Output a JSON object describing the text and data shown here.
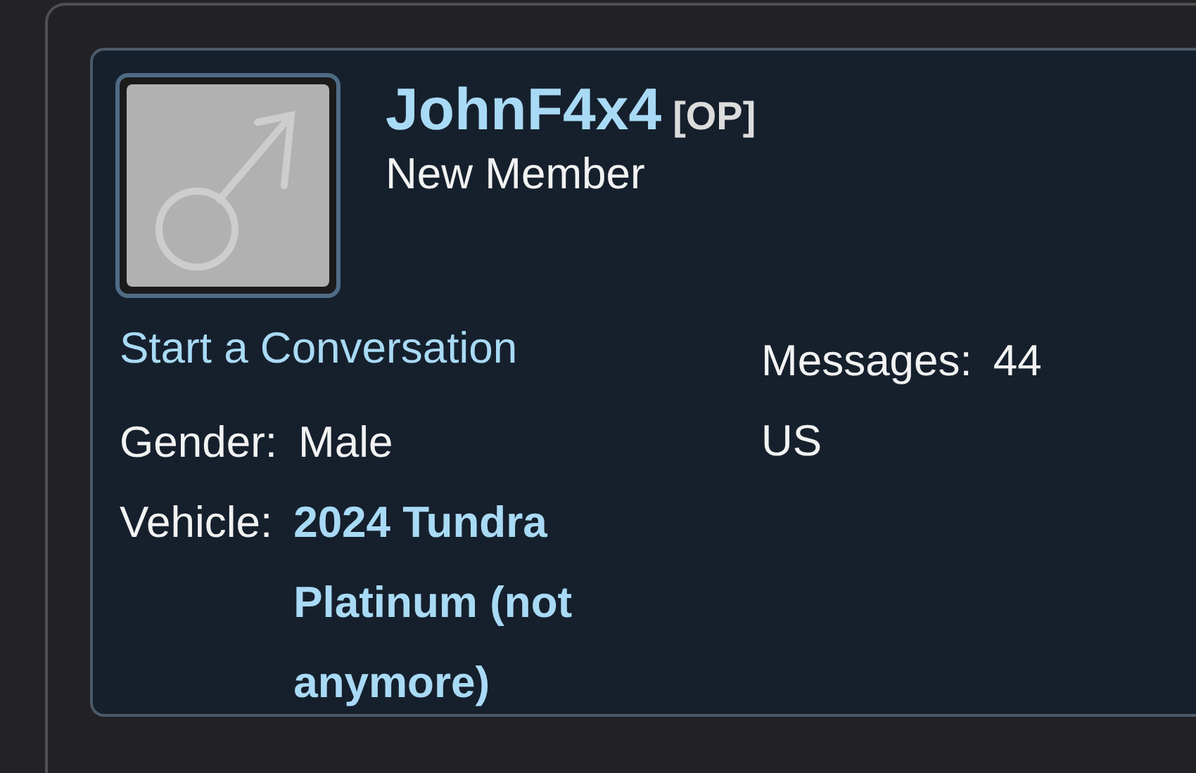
{
  "user": {
    "name": "JohnF4x4",
    "badge": "[OP]",
    "title": "New Member"
  },
  "actions": [
    {
      "label": "Start a Conversation"
    }
  ],
  "fields": [
    {
      "label": "Gender:",
      "value": "Male",
      "kind": "plain"
    },
    {
      "label": "Vehicle:",
      "value": "2024 Tundra Platinum (not anymore)",
      "kind": "link"
    }
  ],
  "stats": [
    {
      "label": "Messages:",
      "value": "44"
    }
  ],
  "location": "US"
}
